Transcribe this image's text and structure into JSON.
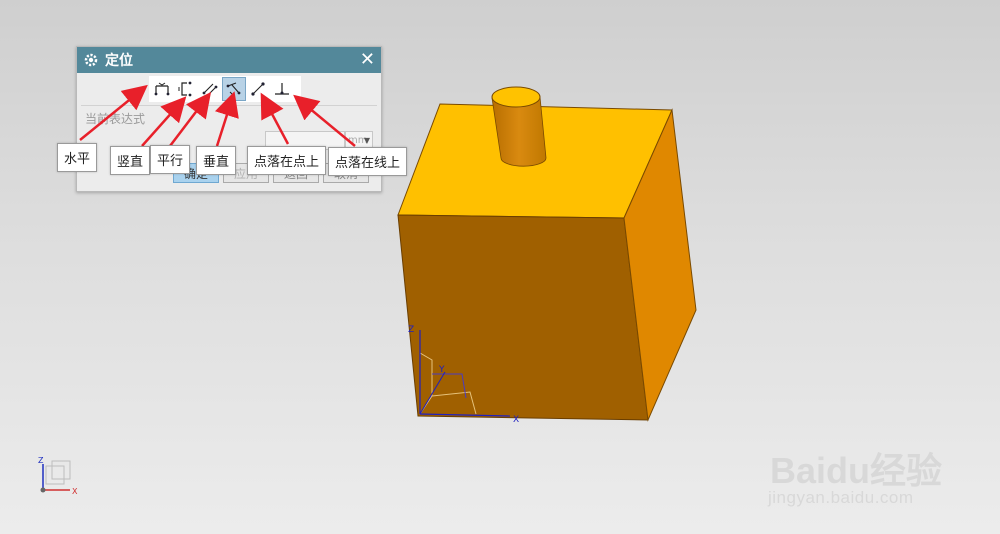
{
  "dialog": {
    "title": "定位",
    "close_symbol": "✕",
    "expression_label": "当前表达式",
    "unit_value": "mm",
    "buttons": {
      "ok": "确定",
      "apply": "应用",
      "back": "返回",
      "cancel": "取消"
    },
    "selected_tool": "perpendicular"
  },
  "callouts": {
    "horizontal": "水平",
    "vertical": "竖直",
    "parallel": "平行",
    "perpendicular": "垂直",
    "point_on_point": "点落在点上",
    "point_on_line": "点落在线上"
  },
  "axes": {
    "x": "X",
    "y": "Y",
    "z": "Z"
  },
  "watermark": {
    "logo": "Baidu经验",
    "site": "jingyan.baidu.com"
  },
  "colors": {
    "title_bar": "#53889a",
    "block_top": "#ffc000",
    "block_front": "#a06000",
    "block_side": "#e08800",
    "arrow": "#e8202a"
  }
}
